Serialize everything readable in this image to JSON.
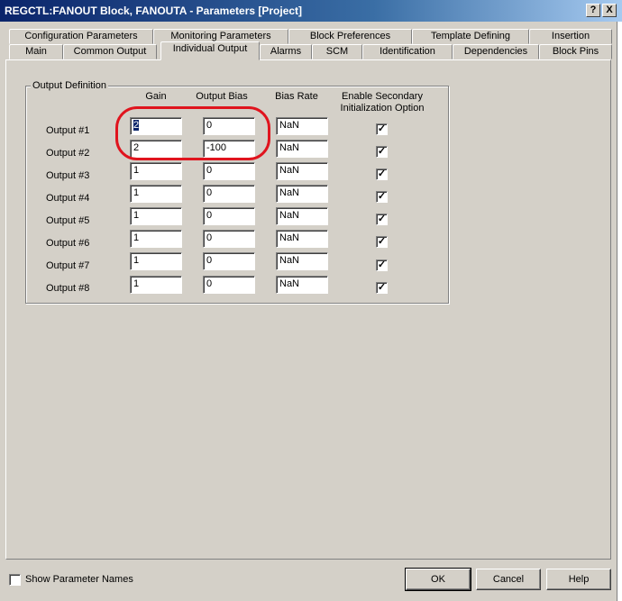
{
  "window": {
    "title": "REGCTL:FANOUT Block, FANOUTA - Parameters [Project]",
    "help_btn": "?",
    "close_btn": "X"
  },
  "tabs_back": [
    {
      "label": "Configuration Parameters"
    },
    {
      "label": "Monitoring Parameters"
    },
    {
      "label": "Block Preferences"
    },
    {
      "label": "Template Defining"
    },
    {
      "label": "Insertion"
    }
  ],
  "tabs_front": [
    {
      "label": "Main"
    },
    {
      "label": "Common Output"
    },
    {
      "label": "Individual Output"
    },
    {
      "label": "Alarms"
    },
    {
      "label": "SCM"
    },
    {
      "label": "Identification"
    },
    {
      "label": "Dependencies"
    },
    {
      "label": "Block Pins"
    }
  ],
  "group": {
    "legend": "Output Definition",
    "headers": {
      "gain": "Gain",
      "bias": "Output Bias",
      "rate": "Bias Rate",
      "secondary_line1": "Enable Secondary",
      "secondary_line2": "Initialization Option"
    },
    "rows": [
      {
        "label": "Output #1",
        "gain": "2",
        "bias": "0",
        "rate": "NaN",
        "check": "✓"
      },
      {
        "label": "Output #2",
        "gain": "2",
        "bias": "-100",
        "rate": "NaN",
        "check": "✓"
      },
      {
        "label": "Output #3",
        "gain": "1",
        "bias": "0",
        "rate": "NaN",
        "check": "✓"
      },
      {
        "label": "Output #4",
        "gain": "1",
        "bias": "0",
        "rate": "NaN",
        "check": "✓"
      },
      {
        "label": "Output #5",
        "gain": "1",
        "bias": "0",
        "rate": "NaN",
        "check": "✓"
      },
      {
        "label": "Output #6",
        "gain": "1",
        "bias": "0",
        "rate": "NaN",
        "check": "✓"
      },
      {
        "label": "Output #7",
        "gain": "1",
        "bias": "0",
        "rate": "NaN",
        "check": "✓"
      },
      {
        "label": "Output #8",
        "gain": "1",
        "bias": "0",
        "rate": "NaN",
        "check": "✓"
      }
    ]
  },
  "footer": {
    "show_names": "Show Parameter Names",
    "ok": "OK",
    "cancel": "Cancel",
    "help": "Help"
  }
}
